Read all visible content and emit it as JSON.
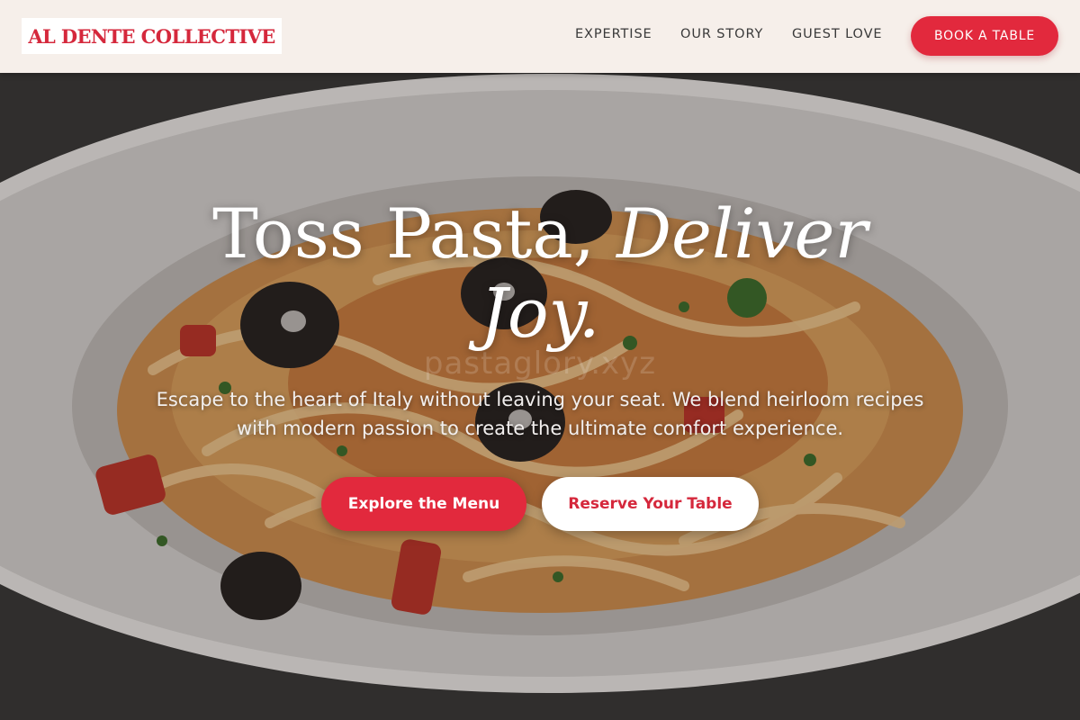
{
  "brand": {
    "name": "AL DENTE COLLECTIVE",
    "accent_color": "#e2293d",
    "header_bg": "#f6efea"
  },
  "nav": {
    "items": [
      {
        "label": "EXPERTISE"
      },
      {
        "label": "OUR STORY"
      },
      {
        "label": "GUEST LOVE"
      }
    ],
    "cta_label": "BOOK A TABLE"
  },
  "hero": {
    "title_plain": "Toss Pasta,",
    "title_accent_1": "Deliver",
    "title_accent_2": "Joy.",
    "subtitle": "Escape to the heart of Italy without leaving your seat. We blend heirloom recipes with modern passion to create the ultimate comfort experience.",
    "primary_cta": "Explore the Menu",
    "secondary_cta": "Reserve Your Table",
    "watermark": "pastaglory.xyz",
    "background_image": "bowl-of-pasta-photo"
  }
}
